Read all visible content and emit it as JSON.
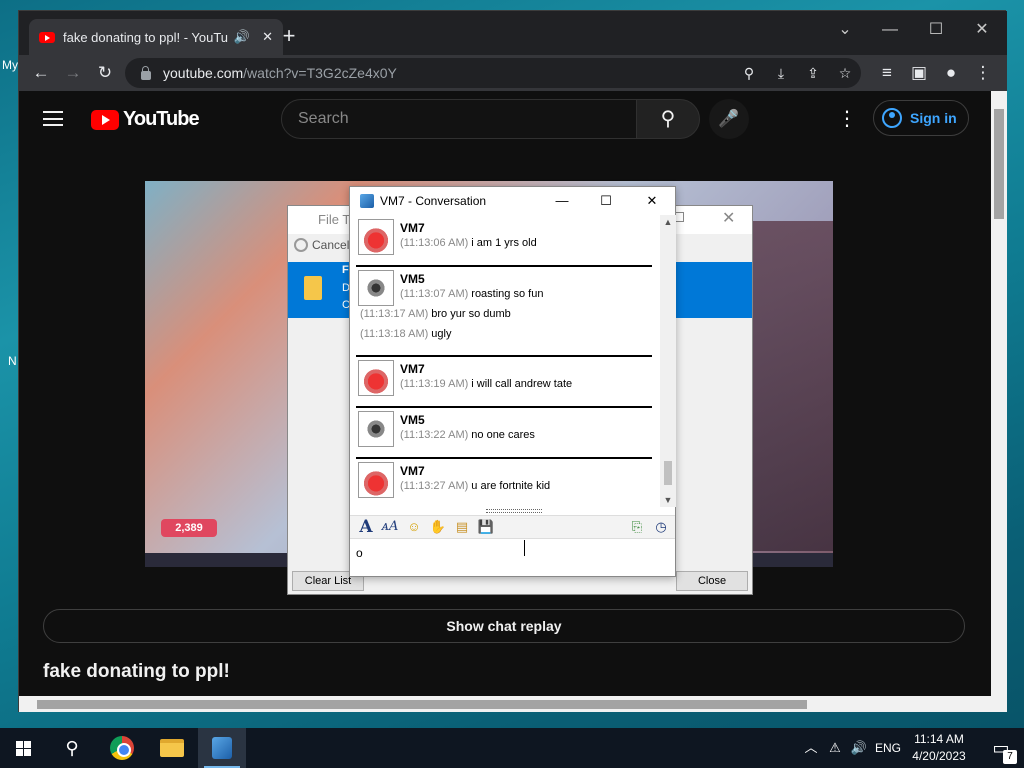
{
  "desktop": {
    "label_top": "My",
    "label_side": "N"
  },
  "browser": {
    "tab": {
      "title": "fake donating to ppl! - YouTu",
      "audio_icon": "speaker-icon",
      "close_icon": "close-icon"
    },
    "new_tab_icon": "plus-icon",
    "window_controls": {
      "tab_search": "⌄",
      "minimize": "—",
      "maximize": "☐",
      "close": "✕"
    },
    "url_host": "youtube.com",
    "url_path": "/watch?v=T3G2cZe4x0Y"
  },
  "youtube": {
    "logo_text": "YouTube",
    "search_placeholder": "Search",
    "sign_in": "Sign in",
    "show_chat_replay": "Show chat replay",
    "video_title": "fake donating to ppl!",
    "video_badge": "2,389"
  },
  "file_transfer": {
    "title": "File Tra",
    "cancel": "Cancel",
    "row_initial": "F",
    "row_line2": "D",
    "row_line3": "C",
    "clear_list": "Clear List",
    "close": "Close"
  },
  "conversation": {
    "title": "VM7 - Conversation",
    "messages": [
      {
        "user": "VM7",
        "avatar": "red",
        "lines": [
          {
            "time": "(11:13:06 AM)",
            "text": "i am 1 yrs old"
          }
        ]
      },
      {
        "user": "VM5",
        "avatar": "gray",
        "lines": [
          {
            "time": "(11:13:07 AM)",
            "text": "roasting so fun"
          },
          {
            "time": "(11:13:17 AM)",
            "text": "bro yur so dumb"
          },
          {
            "time": "(11:13:18 AM)",
            "text": "ugly"
          }
        ]
      },
      {
        "user": "VM7",
        "avatar": "red",
        "lines": [
          {
            "time": "(11:13:19 AM)",
            "text": "i will call andrew tate"
          }
        ]
      },
      {
        "user": "VM5",
        "avatar": "gray",
        "lines": [
          {
            "time": "(11:13:22 AM)",
            "text": "no one cares"
          }
        ]
      },
      {
        "user": "VM7",
        "avatar": "red",
        "lines": [
          {
            "time": "(11:13:27 AM)",
            "text": "u are fortnite kid"
          }
        ]
      }
    ],
    "input_value": "o",
    "format_icons": [
      "font-icon",
      "font-size-icon",
      "emoticon-icon",
      "nudge-icon",
      "send-file-icon",
      "save-icon",
      "paste-icon",
      "history-icon"
    ]
  },
  "taskbar": {
    "language": "ENG",
    "time": "11:14 AM",
    "date": "4/20/2023",
    "notification_count": "7"
  }
}
